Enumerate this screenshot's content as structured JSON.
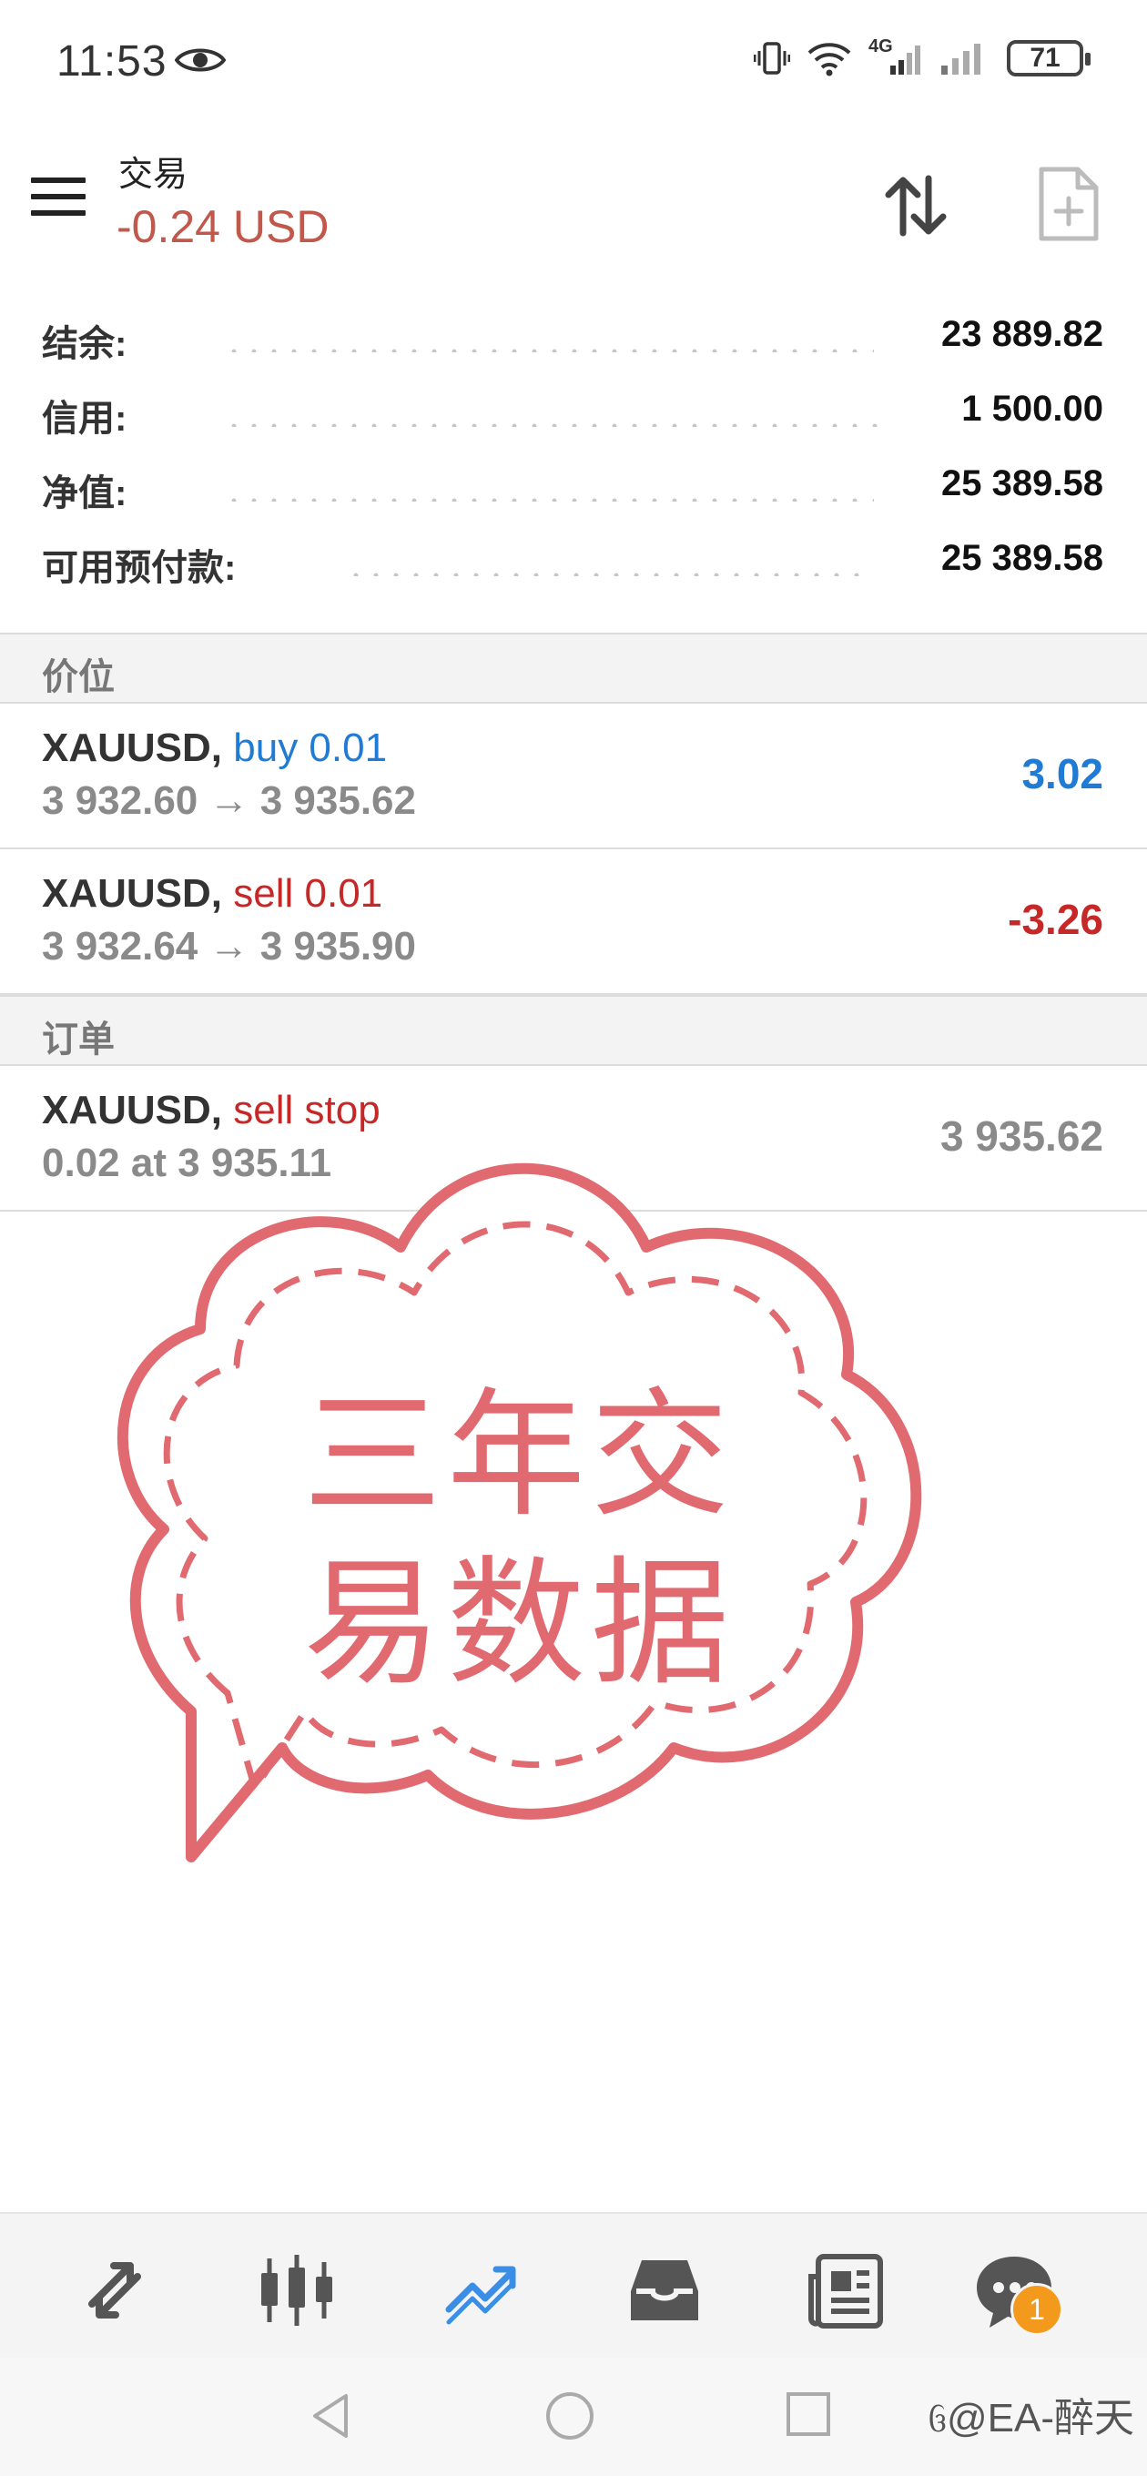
{
  "status_bar": {
    "time": "11:53",
    "network": "4G",
    "battery": "71"
  },
  "header": {
    "title": "交易",
    "profit": "-0.24 USD"
  },
  "summary": [
    {
      "label": "结余:",
      "value": "23 889.82"
    },
    {
      "label": "信用:",
      "value": "1 500.00"
    },
    {
      "label": "净值:",
      "value": "25 389.58"
    },
    {
      "label": "可用预付款:",
      "value": "25 389.58"
    }
  ],
  "positions_section": {
    "title": "价位"
  },
  "positions": [
    {
      "symbol": "XAUUSD,",
      "action": "buy 0.01",
      "prices": "3 932.60 → 3 935.62",
      "profit": "3.02",
      "color": "#1f7bd3"
    },
    {
      "symbol": "XAUUSD,",
      "action": "sell 0.01",
      "prices": "3 932.64 → 3 935.90",
      "profit": "-3.26",
      "color": "#c62828"
    }
  ],
  "orders_section": {
    "title": "订单"
  },
  "orders": [
    {
      "symbol": "XAUUSD,",
      "type": "sell stop",
      "detail": "0.02 at 3 935.11",
      "price": "3 935.62"
    }
  ],
  "sticker": {
    "line1": "三年交",
    "line2": "易数据",
    "color": "#e06a70"
  },
  "bottom_nav": {
    "items": [
      "quotes-icon",
      "chart-icon",
      "trade-icon",
      "history-icon",
      "news-icon",
      "chat-icon"
    ],
    "active": "trade-icon",
    "chat_badge": "1"
  },
  "watermark": "@EA-醉天"
}
